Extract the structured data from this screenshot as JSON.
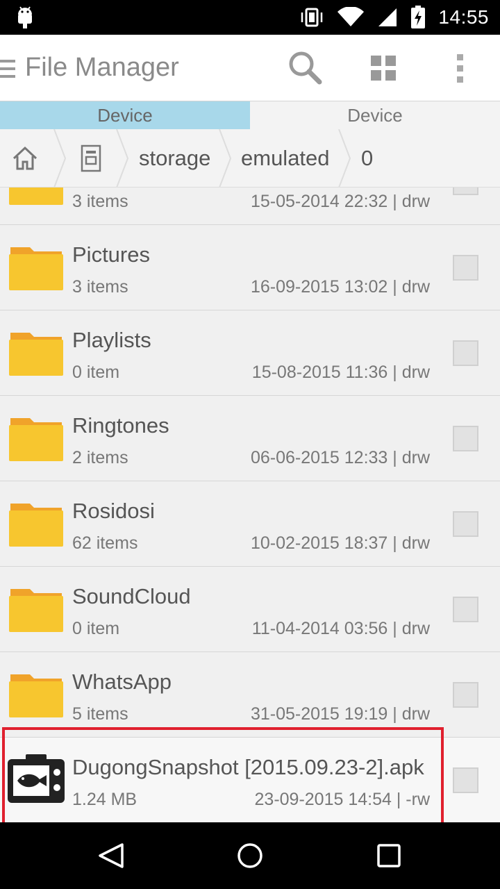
{
  "status_bar": {
    "time": "14:55",
    "icons": [
      "android-icon",
      "vibrate-icon",
      "wifi-icon",
      "signal-icon",
      "battery-charging-icon"
    ]
  },
  "app_bar": {
    "title": "File Manager",
    "actions": [
      "search-icon",
      "grid-view-icon",
      "more-vert-icon"
    ]
  },
  "tabs": [
    {
      "label": "Device",
      "active": true
    },
    {
      "label": "Device",
      "active": false
    }
  ],
  "breadcrumb": {
    "items": [
      "home-icon",
      "sdcard-icon",
      "storage",
      "emulated",
      "0"
    ]
  },
  "files": [
    {
      "name": "",
      "sub": "3 items",
      "meta": "15-05-2014 22:32 | drw",
      "type": "folder"
    },
    {
      "name": "Pictures",
      "sub": "3 items",
      "meta": "16-09-2015 13:02 | drw",
      "type": "folder"
    },
    {
      "name": "Playlists",
      "sub": "0 item",
      "meta": "15-08-2015 11:36 | drw",
      "type": "folder"
    },
    {
      "name": "Ringtones",
      "sub": "2 items",
      "meta": "06-06-2015 12:33 | drw",
      "type": "folder"
    },
    {
      "name": "Rosidosi",
      "sub": "62 items",
      "meta": "10-02-2015 18:37 | drw",
      "type": "folder"
    },
    {
      "name": "SoundCloud",
      "sub": "0 item",
      "meta": "11-04-2014 03:56 | drw",
      "type": "folder"
    },
    {
      "name": "WhatsApp",
      "sub": "5 items",
      "meta": "31-05-2015 19:19 | drw",
      "type": "folder"
    },
    {
      "name": "DugongSnapshot [2015.09.23-2].apk",
      "sub": "1.24 MB",
      "meta": "23-09-2015 14:54 | -rw",
      "type": "apk"
    }
  ],
  "colors": {
    "tab_active": "#a8d8ea",
    "folder": "#f7c62f",
    "folder_tab": "#f0a32a",
    "highlight": "#e0202e"
  },
  "nav_bar": [
    "back-icon",
    "home-circle-icon",
    "recents-icon"
  ]
}
